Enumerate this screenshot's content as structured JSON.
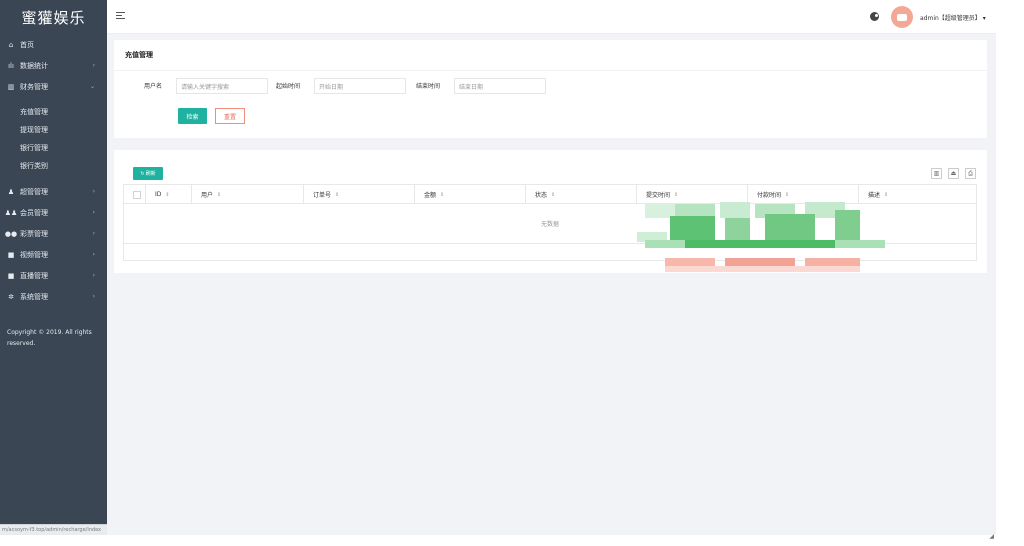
{
  "sidebar": {
    "logo": "蜜獾娱乐",
    "items": [
      {
        "label": "首页",
        "icon": "home-icon",
        "glyph": "⌂",
        "arrow": false
      },
      {
        "label": "数据统计",
        "icon": "bar-chart-icon",
        "glyph": "ılı",
        "arrow": true
      },
      {
        "label": "财务管理",
        "icon": "bank-icon",
        "glyph": "▥",
        "arrow": true,
        "expanded": true
      }
    ],
    "sub_items": [
      "充值管理",
      "提现管理",
      "银行管理",
      "银行类别"
    ],
    "items_after": [
      {
        "label": "超管管理",
        "icon": "user-icon",
        "glyph": "♟",
        "arrow": true
      },
      {
        "label": "会员管理",
        "icon": "users-icon",
        "glyph": "♟♟",
        "arrow": true
      },
      {
        "label": "彩票管理",
        "icon": "gamepad-icon",
        "glyph": "●●",
        "arrow": true
      },
      {
        "label": "视频管理",
        "icon": "video-icon",
        "glyph": "■",
        "arrow": true
      },
      {
        "label": "直播管理",
        "icon": "live-icon",
        "glyph": "■",
        "arrow": true
      },
      {
        "label": "系统管理",
        "icon": "gear-icon",
        "glyph": "✲",
        "arrow": true
      }
    ],
    "copyright": "Copyright © 2019. All rights reserved.",
    "status_url": "m/acsoym-f3.top/admin/recharge/index"
  },
  "topbar": {
    "user_label": "admin【超级管理员】",
    "caret": "▾"
  },
  "panel": {
    "title": "充值管理",
    "fields": [
      {
        "label": "用户名",
        "placeholder": "请输入关键字搜索"
      },
      {
        "label": "起始时间",
        "placeholder": "开始日期"
      },
      {
        "label": "结束时间",
        "placeholder": "结束日期"
      }
    ],
    "search_button": "检索",
    "reset_button": "重置"
  },
  "table": {
    "refresh_button": "刷新",
    "tool_icons": [
      "columns-icon",
      "export-icon",
      "print-icon"
    ],
    "columns": [
      "ID",
      "用户",
      "订单号",
      "金额",
      "状态",
      "提交时间",
      "付款时间",
      "描述"
    ],
    "empty_text": "无数据"
  },
  "colors": {
    "sidebar_bg": "#3a4654",
    "accent": "#20b2a0",
    "reset": "#ea6e56",
    "content_bg": "#f2f3f7"
  }
}
